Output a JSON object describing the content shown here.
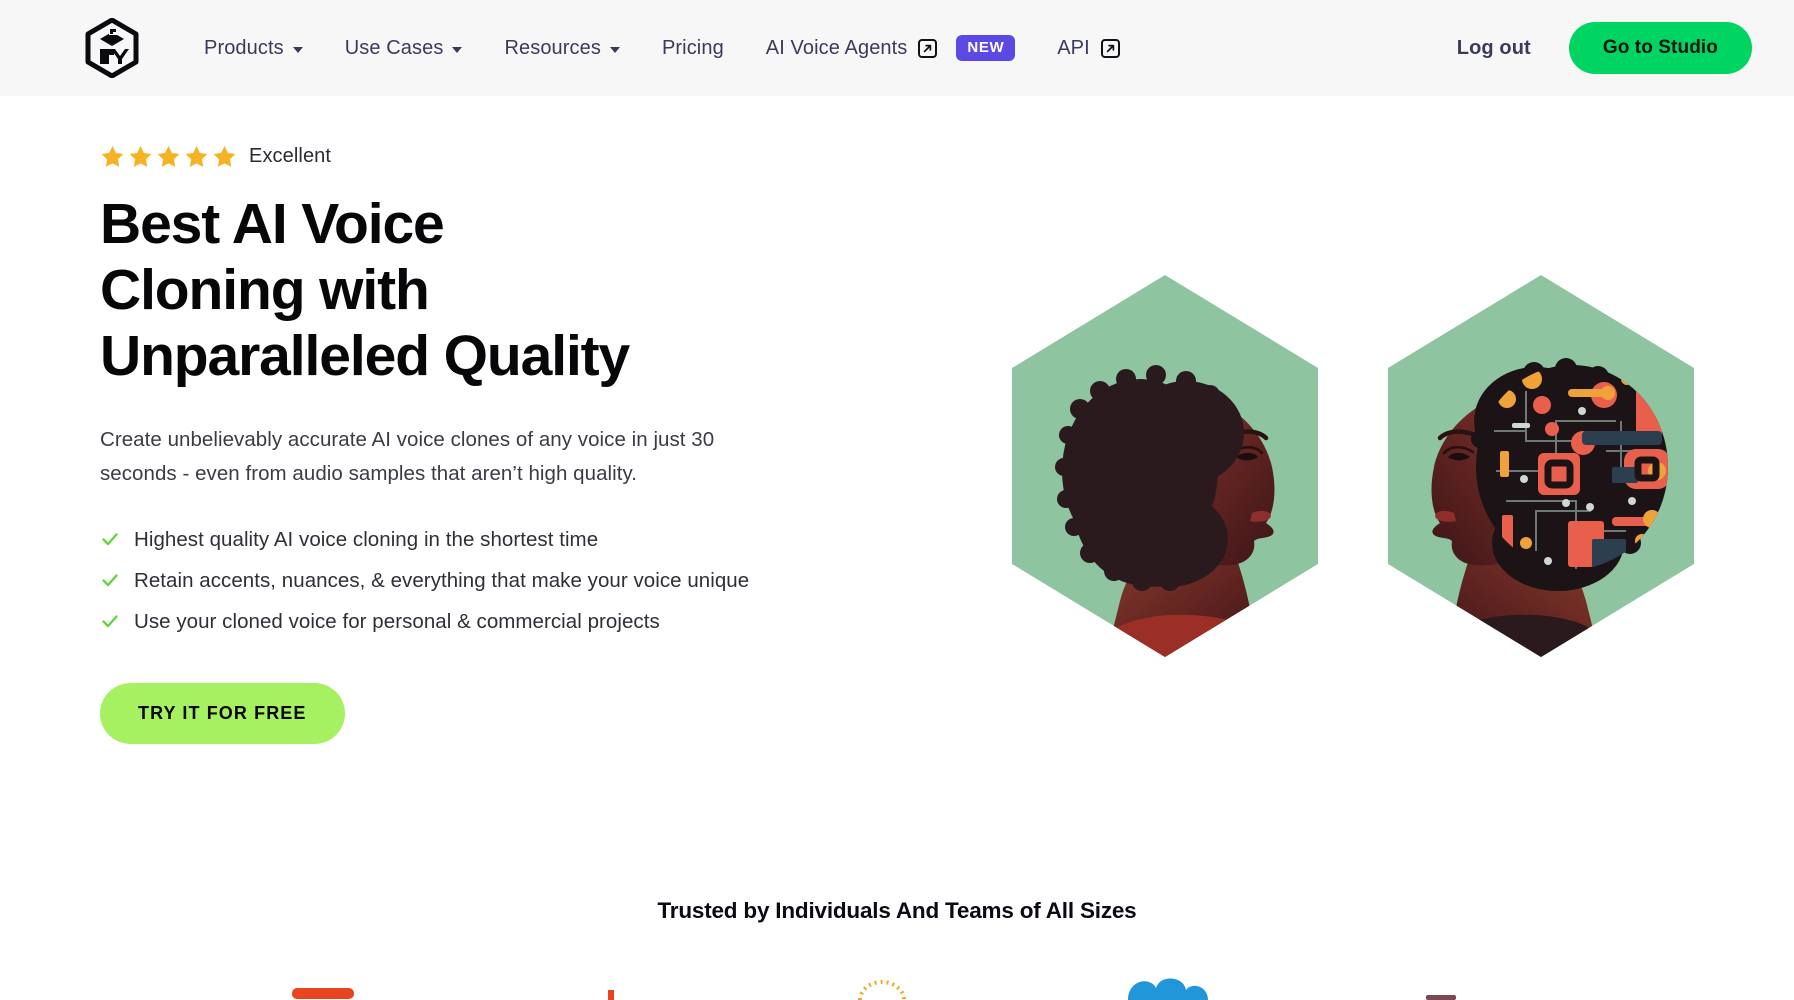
{
  "brand": {
    "logo_name": "playht-cube-logo"
  },
  "header": {
    "nav": [
      {
        "label": "Products",
        "has_dropdown": true,
        "external": false,
        "badge": null
      },
      {
        "label": "Use Cases",
        "has_dropdown": true,
        "external": false,
        "badge": null
      },
      {
        "label": "Resources",
        "has_dropdown": true,
        "external": false,
        "badge": null
      },
      {
        "label": "Pricing",
        "has_dropdown": false,
        "external": false,
        "badge": null
      },
      {
        "label": "AI Voice Agents",
        "has_dropdown": false,
        "external": true,
        "badge": "NEW"
      },
      {
        "label": "API",
        "has_dropdown": false,
        "external": true,
        "badge": null
      }
    ],
    "logout_label": "Log out",
    "studio_button_label": "Go to Studio"
  },
  "hero": {
    "rating": {
      "stars": 5,
      "label": "Excellent"
    },
    "headline": "Best AI Voice Cloning with Unparalleled Quality",
    "subtext": "Create unbelievably accurate AI voice clones of any voice in just 30 seconds - even from audio samples that aren’t high quality.",
    "features": [
      "Highest quality AI voice cloning in the shortest time",
      "Retain accents, nuances, & everything that make your voice unique",
      "Use your cloned voice for personal & commercial projects"
    ],
    "cta_label": "TRY IT FOR FREE",
    "art": [
      {
        "name": "hexagon-portrait-afro",
        "alt": "Profile illustration of a woman with an afro on a sage green hexagon"
      },
      {
        "name": "hexagon-portrait-circuit-brain",
        "alt": "Profile illustration of a woman whose hair is a circuit board on a sage green hexagon"
      }
    ]
  },
  "trusted": {
    "heading": "Trusted by Individuals And Teams of All Sizes",
    "logos": [
      {
        "name": "partner-logo-red",
        "color": "#e8441f"
      },
      {
        "name": "partner-logo-orange-dots",
        "color": "#f29100"
      },
      {
        "name": "partner-logo-orange-arc",
        "color": "#f5a623"
      },
      {
        "name": "partner-logo-blue-cloud",
        "color": "#2196d8"
      },
      {
        "name": "partner-logo-maroon-bar",
        "color": "#7a4a52"
      }
    ]
  },
  "colors": {
    "header_bg": "#f7f7f8",
    "nav_text": "#3a3a5c",
    "badge_new": "#5a4ae3",
    "studio_green": "#00d563",
    "cta_green": "#a6f161",
    "star_gold": "#f5b223",
    "check_green": "#62d23f",
    "hex_sage": "#8fc4a0"
  }
}
